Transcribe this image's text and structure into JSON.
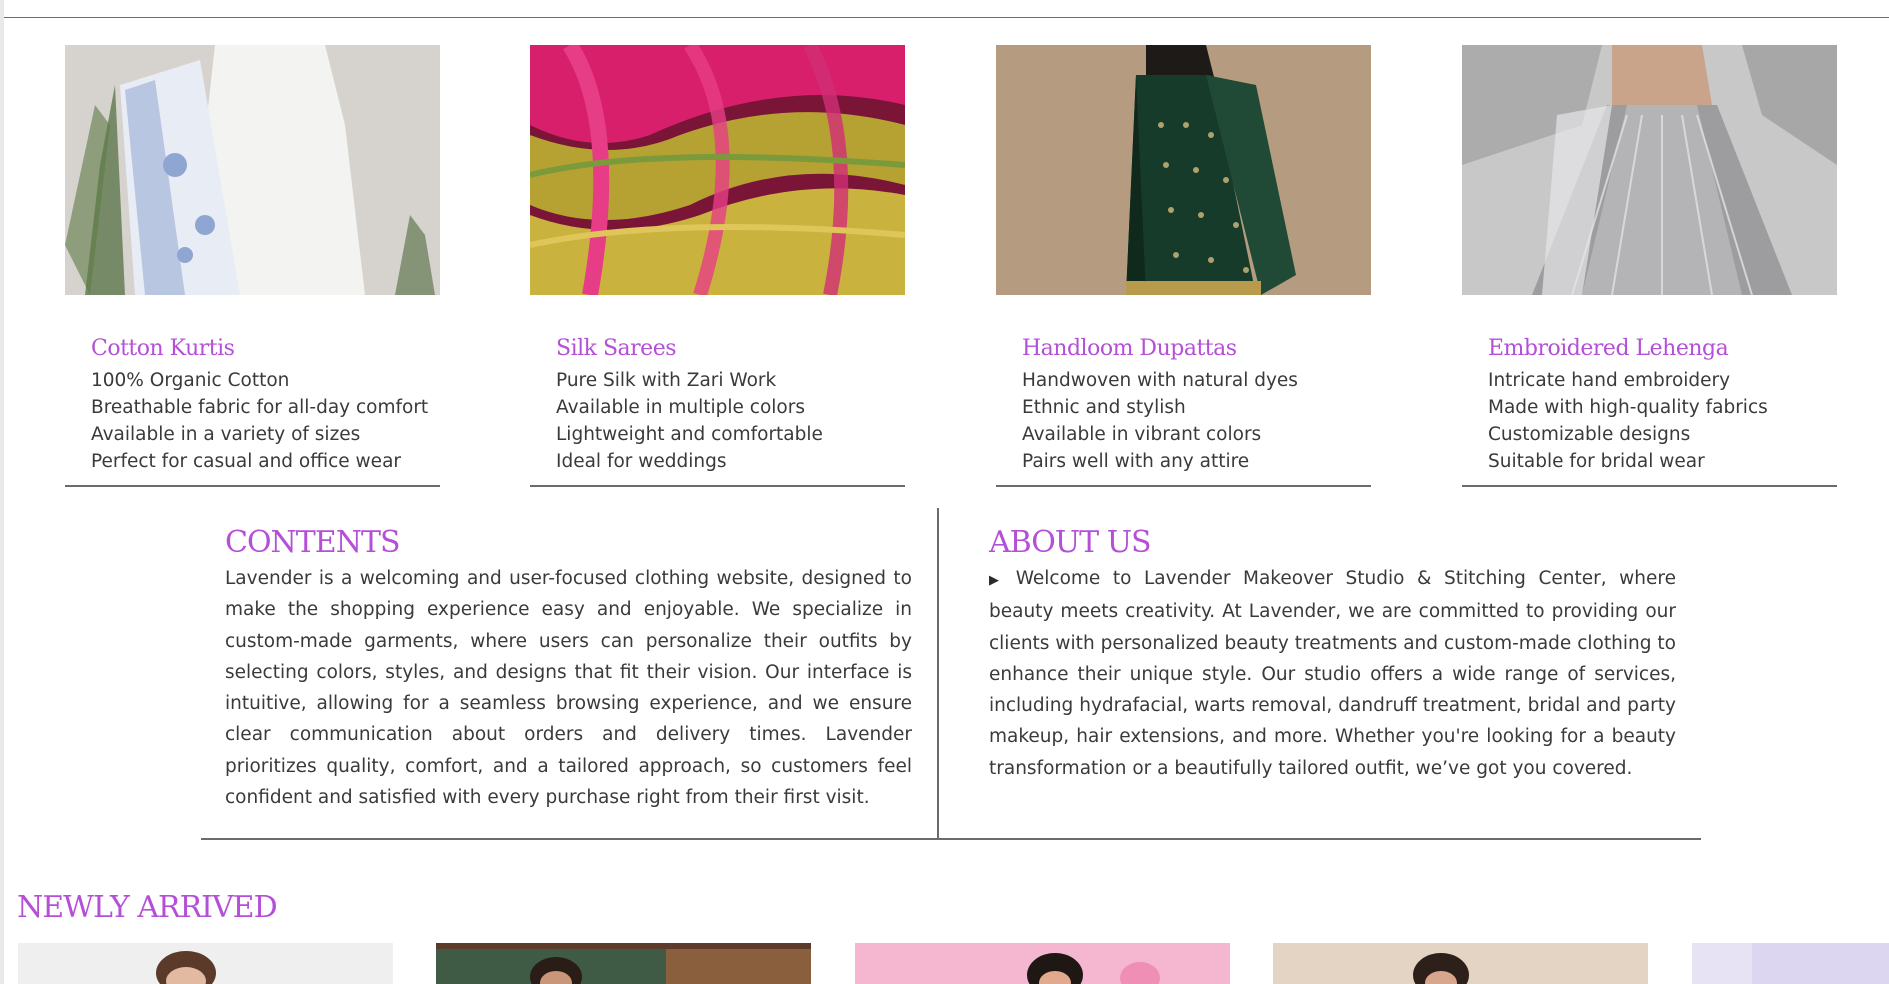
{
  "products": [
    {
      "title": "Cotton Kurtis",
      "features": [
        "100% Organic Cotton",
        "Breathable fabric for all-day comfort",
        "Available in a variety of sizes",
        "Perfect for casual and office wear"
      ]
    },
    {
      "title": "Silk Sarees",
      "features": [
        "Pure Silk with Zari Work",
        "Available in multiple colors",
        "Lightweight and comfortable",
        "Ideal for weddings"
      ]
    },
    {
      "title": "Handloom Dupattas",
      "features": [
        "Handwoven with natural dyes",
        "Ethnic and stylish",
        "Available in vibrant colors",
        "Pairs well with any attire"
      ]
    },
    {
      "title": "Embroidered Lehenga",
      "features": [
        "Intricate hand embroidery",
        "Made with high-quality fabrics",
        "Customizable designs",
        "Suitable for bridal wear"
      ]
    }
  ],
  "contents": {
    "title": "CONTENTS",
    "text": "Lavender is a welcoming and user-focused clothing website, designed to make the shopping experience easy and enjoyable. We specialize in custom-made garments, where users can personalize their outfits by selecting colors, styles, and designs that fit their vision. Our interface is intuitive, allowing for a seamless browsing experience, and we ensure clear communication about orders and delivery times. Lavender prioritizes quality, comfort, and a tailored approach, so customers feel confident and satisfied with every purchase right from their first visit."
  },
  "about": {
    "title": "ABOUT US",
    "marker": "▶",
    "text": "Welcome to Lavender Makeover Studio & Stitching Center, where beauty meets creativity. At Lavender, we are committed to providing our clients with personalized beauty treatments and custom-made clothing to enhance their unique style. Our studio offers a wide range of services, including hydrafacial, warts removal, dandruff treatment, bridal and party makeup, hair extensions, and more. Whether you're looking for a beauty transformation or a beautifully tailored outfit, we’ve got you covered."
  },
  "newly_arrived": {
    "title": "NEWLY ARRIVED"
  },
  "colors": {
    "accent": "#b44fd8",
    "text": "#3a3a3a",
    "rule": "#6b6b6b"
  }
}
